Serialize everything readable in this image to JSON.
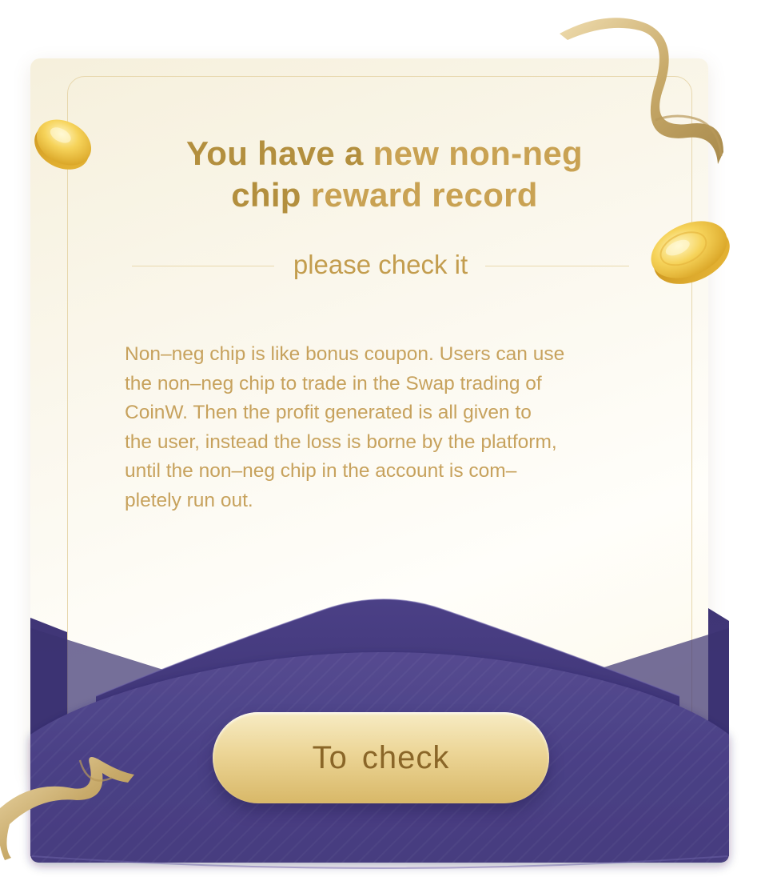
{
  "card": {
    "title_part1": "You have a ",
    "title_part2": "new non-neg",
    "title_part3": "chip",
    "title_part4": " reward record",
    "subtitle": "please check it",
    "body_lines": [
      "Non–neg chip is like bonus coupon. Users can use",
      "the non–neg chip to trade in the Swap trading of",
      "CoinW. Then the profit generated is all given to",
      "the user, instead the loss is borne by the platform,",
      "until the non–neg chip in the account is com–",
      "pletely run out."
    ]
  },
  "action": {
    "button_label": "To check"
  },
  "colors": {
    "gold_title": "#b38f3e",
    "gold_text": "#c7a25d",
    "envelope_purple": "#4a3f82",
    "button_gold": "#ecd596"
  },
  "icons": [
    "gold-coin-icon",
    "gold-ribbon-icon"
  ]
}
